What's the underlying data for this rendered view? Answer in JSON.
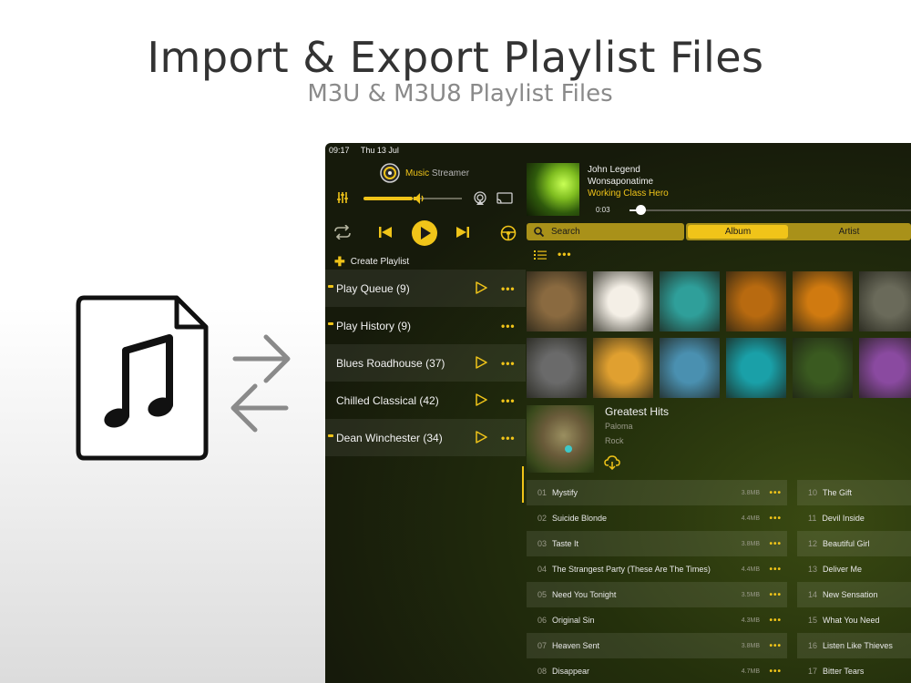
{
  "hero": {
    "title": "Import & Export Playlist Files",
    "subtitle": "M3U & M3U8 Playlist Files"
  },
  "icons": {
    "file": "music-file-icon",
    "swap": "import-export-arrows-icon"
  },
  "status": {
    "time": "09:17",
    "date": "Thu 13 Jul"
  },
  "app": {
    "name_accent": "Music",
    "name_rest": " Streamer",
    "accent_color": "#f0c419"
  },
  "volume": {
    "level": 0.5
  },
  "controls": {
    "create_playlist": "Create Playlist"
  },
  "playlists": [
    {
      "label": "Play Queue (9)",
      "marked": true,
      "playable": true
    },
    {
      "label": "Play History (9)",
      "marked": true,
      "playable": false
    },
    {
      "label": "Blues Roadhouse (37)",
      "marked": false,
      "playable": true
    },
    {
      "label": "Chilled Classical (42)",
      "marked": false,
      "playable": true
    },
    {
      "label": "Dean Winchester (34)",
      "marked": true,
      "playable": true
    }
  ],
  "now_playing": {
    "artist": "John Legend",
    "title": "Wonsaponatime",
    "album": "Working Class Hero",
    "elapsed": "0:03",
    "progress": 0.04
  },
  "search": {
    "label": "Search"
  },
  "tabs": {
    "album": "Album",
    "artist": "Artist",
    "active": "Album"
  },
  "album": {
    "name": "Greatest Hits",
    "artist": "Paloma",
    "genre": "Rock"
  },
  "tracks_left": [
    {
      "num": "01",
      "title": "Mystify",
      "size": "3.8MB"
    },
    {
      "num": "02",
      "title": "Suicide Blonde",
      "size": "4.4MB"
    },
    {
      "num": "03",
      "title": "Taste It",
      "size": "3.8MB"
    },
    {
      "num": "04",
      "title": "The Strangest Party (These Are The Times)",
      "size": "4.4MB"
    },
    {
      "num": "05",
      "title": "Need You Tonight",
      "size": "3.5MB"
    },
    {
      "num": "06",
      "title": "Original Sin",
      "size": "4.3MB"
    },
    {
      "num": "07",
      "title": "Heaven Sent",
      "size": "3.8MB"
    },
    {
      "num": "08",
      "title": "Disappear",
      "size": "4.7MB"
    }
  ],
  "tracks_right": [
    {
      "num": "10",
      "title": "The Gift"
    },
    {
      "num": "11",
      "title": "Devil Inside"
    },
    {
      "num": "12",
      "title": "Beautiful Girl"
    },
    {
      "num": "13",
      "title": "Deliver Me"
    },
    {
      "num": "14",
      "title": "New Sensation"
    },
    {
      "num": "15",
      "title": "What You Need"
    },
    {
      "num": "16",
      "title": "Listen Like Thieves"
    },
    {
      "num": "17",
      "title": "Bitter Tears"
    }
  ],
  "album_grid_colors": [
    [
      "#8a6a40",
      "#f4efe6",
      "#2f9f9a",
      "#b86a10",
      "#d07a10",
      "#6a6a5a"
    ],
    [
      "#6a6a6a",
      "#e0a030",
      "#4a90b0",
      "#1aa0a8",
      "#3a5a20",
      "#8a4aa0"
    ]
  ]
}
